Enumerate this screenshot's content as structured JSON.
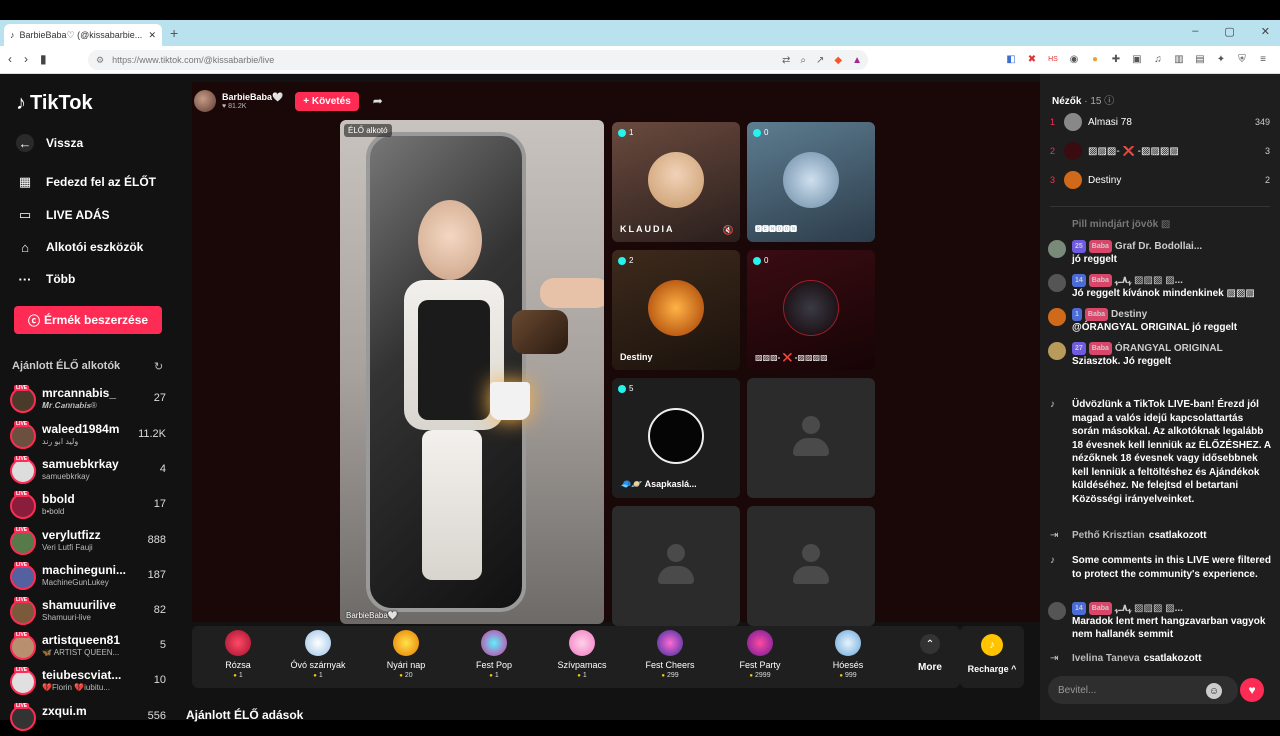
{
  "browser": {
    "tab_title": "BarbieBaba♡ (@kissabarbie...",
    "url": "https://www.tiktok.com/@kissabarbie/live",
    "new_tab": "+",
    "window_controls": [
      "–",
      "▢",
      "✕"
    ]
  },
  "sidebar": {
    "logo": "TikTok",
    "back": "Vissza",
    "nav": [
      {
        "label": "Fedezd fel az ÉLŐT",
        "icon": "calendar-icon"
      },
      {
        "label": "LIVE ADÁS",
        "icon": "video-icon"
      },
      {
        "label": "Alkotói eszközök",
        "icon": "home-icon"
      },
      {
        "label": "Több",
        "icon": "more-icon"
      }
    ],
    "coins_button": "Érmék beszerzése",
    "recommended_title": "Ajánlott ÉLŐ alkotók",
    "creators": [
      {
        "name": "mrcannabis_",
        "sub": "𝑴𝒓.𝑪𝒂𝒏𝒏𝒂𝒃𝒊𝒔®",
        "count": "27"
      },
      {
        "name": "waleed1984m",
        "sub": "وليد ابو رند",
        "count": "11.2K"
      },
      {
        "name": "samuebkrkay",
        "sub": "samuebkrkay",
        "count": "4"
      },
      {
        "name": "bbold",
        "sub": "b•bold",
        "count": "17"
      },
      {
        "name": "verylutfizz",
        "sub": "Veri Lutfi Fauji",
        "count": "888"
      },
      {
        "name": "machineguni...",
        "sub": "MachineGunLukey",
        "count": "187"
      },
      {
        "name": "shamuurilive",
        "sub": "Shamuuri-live",
        "count": "82"
      },
      {
        "name": "artistqueen81",
        "sub": "🦋 ARTIST QUEEN...",
        "count": "5"
      },
      {
        "name": "teiubescviat...",
        "sub": "💔Florin 💔iubitu...",
        "count": "10"
      },
      {
        "name": "zxqui.m",
        "sub": "",
        "count": "556"
      }
    ]
  },
  "stream": {
    "host_name": "BarbieBaba🤍",
    "host_followers": "♥ 81.2K",
    "follow_label": "+ Követés",
    "main_label": "ÉLŐ alkotó",
    "main_caption": "BarbieBaba🤍",
    "tiles": [
      {
        "count": "1",
        "name": "KLAUDIA"
      },
      {
        "count": "0",
        "name": "🅱🅴🅽🅳🅾🅽"
      },
      {
        "count": "2",
        "name": "Destiny"
      },
      {
        "count": "0",
        "name": "▨▨▨- ❌ -▨▨▨▨"
      },
      {
        "count": "5",
        "name": "🧢🪐 Asapkaslá..."
      }
    ],
    "gifts": [
      {
        "name": "Rózsa",
        "price": "1"
      },
      {
        "name": "Óvó szárnyak",
        "price": "1"
      },
      {
        "name": "Nyári nap",
        "price": "20"
      },
      {
        "name": "Fest Pop",
        "price": "1"
      },
      {
        "name": "Szívpamacs",
        "price": "1"
      },
      {
        "name": "Fest Cheers",
        "price": "299"
      },
      {
        "name": "Fest Party",
        "price": "2999"
      },
      {
        "name": "Hóesés",
        "price": "999"
      }
    ],
    "more_label": "More",
    "recharge_label": "Recharge ^",
    "recommended_live": "Ajánlott ÉLŐ adások"
  },
  "chat": {
    "viewers_title": "Nézők",
    "viewers_count": "· 15",
    "viewers": [
      {
        "rank": "1",
        "name": "Almasi 78",
        "score": "349"
      },
      {
        "rank": "2",
        "name": "▨▨▨- ❌ -▨▨▨▨",
        "score": "3"
      },
      {
        "rank": "3",
        "name": "Destiny",
        "score": "2"
      }
    ],
    "faded": "Pill mindjárt jövök ▨",
    "comments": [
      {
        "lvl": "25",
        "fan": "Baba",
        "user": "Graf Dr. Bodollai...",
        "text": "jó reggelt"
      },
      {
        "lvl": "14",
        "fan": "Baba",
        "user": "ﮩ٨ـﮩ ▨▨▨ ▨...",
        "text": "Jó reggelt kívánok mindenkinek ▨▨▨"
      },
      {
        "lvl": "1",
        "fan": "Baba",
        "user": "Destiny",
        "text": "@ÓRANGYAL ORIGINAL jó reggelt"
      },
      {
        "lvl": "27",
        "fan": "Baba",
        "user": "ÓRANGYAL ORIGINAL",
        "text": "Sziasztok. Jó reggelt"
      }
    ],
    "welcome": "Üdvözlünk a TikTok LIVE-ban! Érezd jól magad a valós idejű kapcsolattartás során másokkal. Az alkotóknak legalább 18 évesnek kell lenniük az ÉLŐZÉSHEZ. A nézőknek 18 évesnek vagy idősebbnek kell lenniük a feltöltéshez és Ajándékok küldéséhez. Ne felejtsd el betartani Közösségi irányelveinket.",
    "join1_user": "Pethő Krisztian",
    "join_label": "csatlakozott",
    "filtered": "Some comments in this LIVE were filtered to protect the community's experience.",
    "comment5": {
      "lvl": "14",
      "fan": "Baba",
      "user": "ﮩ٨ـﮩ ▨▨▨ ▨...",
      "text": "Maradok lent mert hangzavarban vagyok nem hallanék semmit"
    },
    "join2_user": "Ivelina Taneva",
    "input_placeholder": "Bevitel..."
  }
}
